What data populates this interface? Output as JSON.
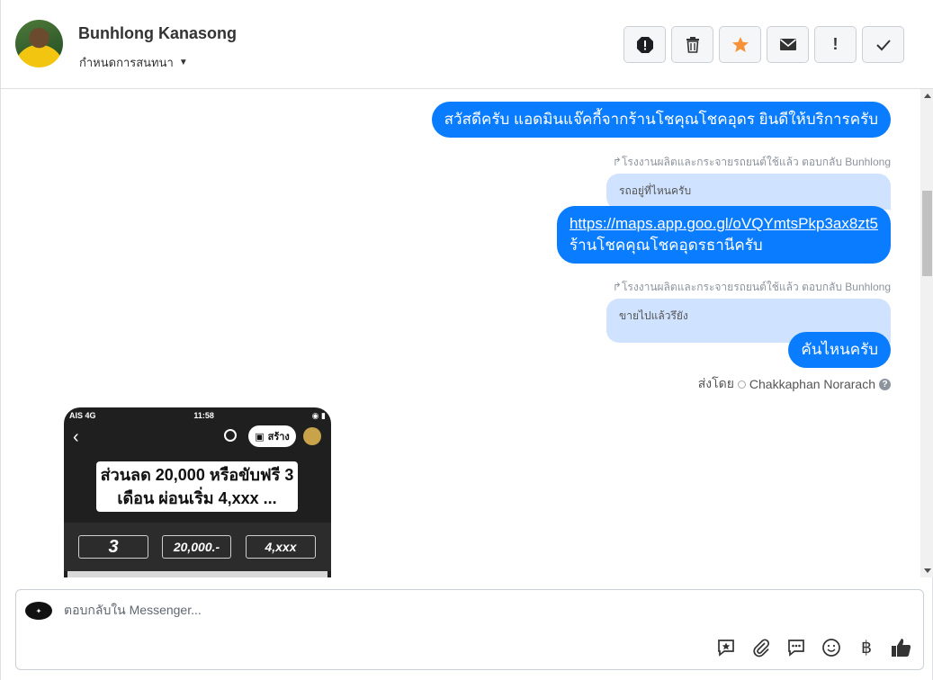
{
  "header": {
    "user_name": "Bunhlong Kanasong",
    "conversation_status": "กำหนดการสนทนา",
    "toolbar": [
      {
        "name": "report-spam-button",
        "icon": "alert-octagon-icon"
      },
      {
        "name": "delete-button",
        "icon": "trash-icon"
      },
      {
        "name": "star-button",
        "icon": "star-icon",
        "color": "#f7923b"
      },
      {
        "name": "mark-unread-button",
        "icon": "envelope-icon"
      },
      {
        "name": "flag-important-button",
        "icon": "exclamation-icon"
      },
      {
        "name": "mark-done-button",
        "icon": "check-icon"
      }
    ]
  },
  "messages": {
    "greeting": "สวัสดีครับ แอดมินแจ๊คกี้จากร้านโชคุณโชคอุดร ยินดีให้บริการครับ",
    "reply_meta_1": "โรงงานผลิตและกระจายรถยนต์ใช้แล้ว ตอบกลับ Bunhlong",
    "quoted_1": "รถอยู่ที่ไหนครับ",
    "link": "https://maps.app.goo.gl/oVQYmtsPkp3ax8zt5",
    "link_caption": "ร้านโชคคุณโชคอุดรธานีครับ",
    "reply_meta_2": "โรงงานผลิตและกระจายรถยนต์ใช้แล้ว ตอบกลับ Bunhlong",
    "quoted_2": "ขายไปแล้วรึยัง",
    "answer": "คันไหนครับ",
    "sent_by_label": "ส่งโดย",
    "sent_by_name": "Chakkaphan Norarach"
  },
  "image_message": {
    "carrier": "AIS  4G",
    "time": "11:58",
    "create_label": "สร้าง",
    "headline": "ส่วนลด 20,000 หรือขับฟรี 3 เดือน ผ่อนเริ่ม 4,xxx ...",
    "box_1_value": "3",
    "box_2_value": "20,000.-",
    "box_3_value": "4,xxx"
  },
  "composer": {
    "placeholder": "ตอบกลับใน Messenger...",
    "tools": [
      "saved-reply-icon",
      "attachment-icon",
      "quick-reply-icon",
      "emoji-icon",
      "baht-icon",
      "thumbs-up-icon"
    ]
  },
  "colors": {
    "accent": "#0a7cff",
    "quoted_bg": "#cfe2ff"
  }
}
